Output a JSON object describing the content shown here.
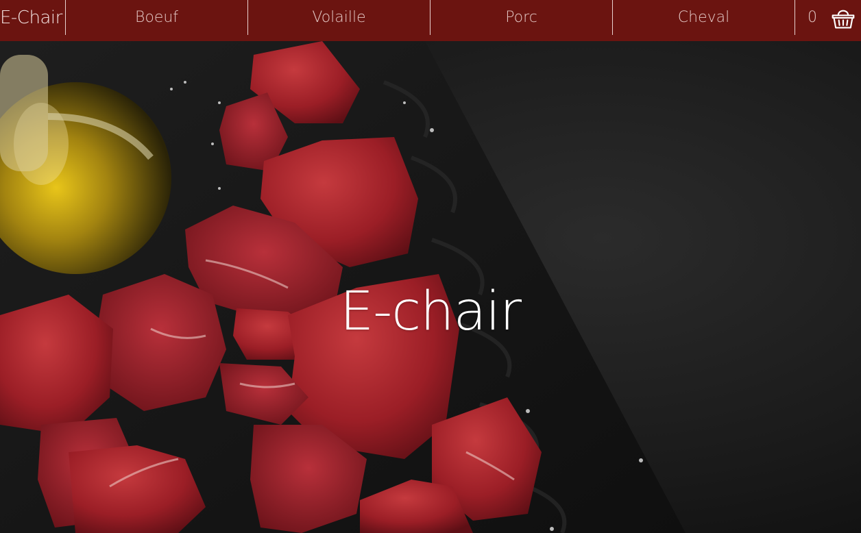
{
  "navbar": {
    "brand": "E-Chair",
    "items": [
      {
        "label": "Boeuf"
      },
      {
        "label": "Volaille"
      },
      {
        "label": "Porc"
      },
      {
        "label": "Cheval"
      }
    ],
    "cart": {
      "count": "0",
      "icon": "basket-icon"
    }
  },
  "hero": {
    "title": "E-chair",
    "image": "raw-beef-chunks-with-olive-oil-on-dark-slate"
  },
  "colors": {
    "navbar_bg": "#6b1410",
    "nav_text": "#e3c7c4",
    "hero_title": "#ffffff"
  }
}
